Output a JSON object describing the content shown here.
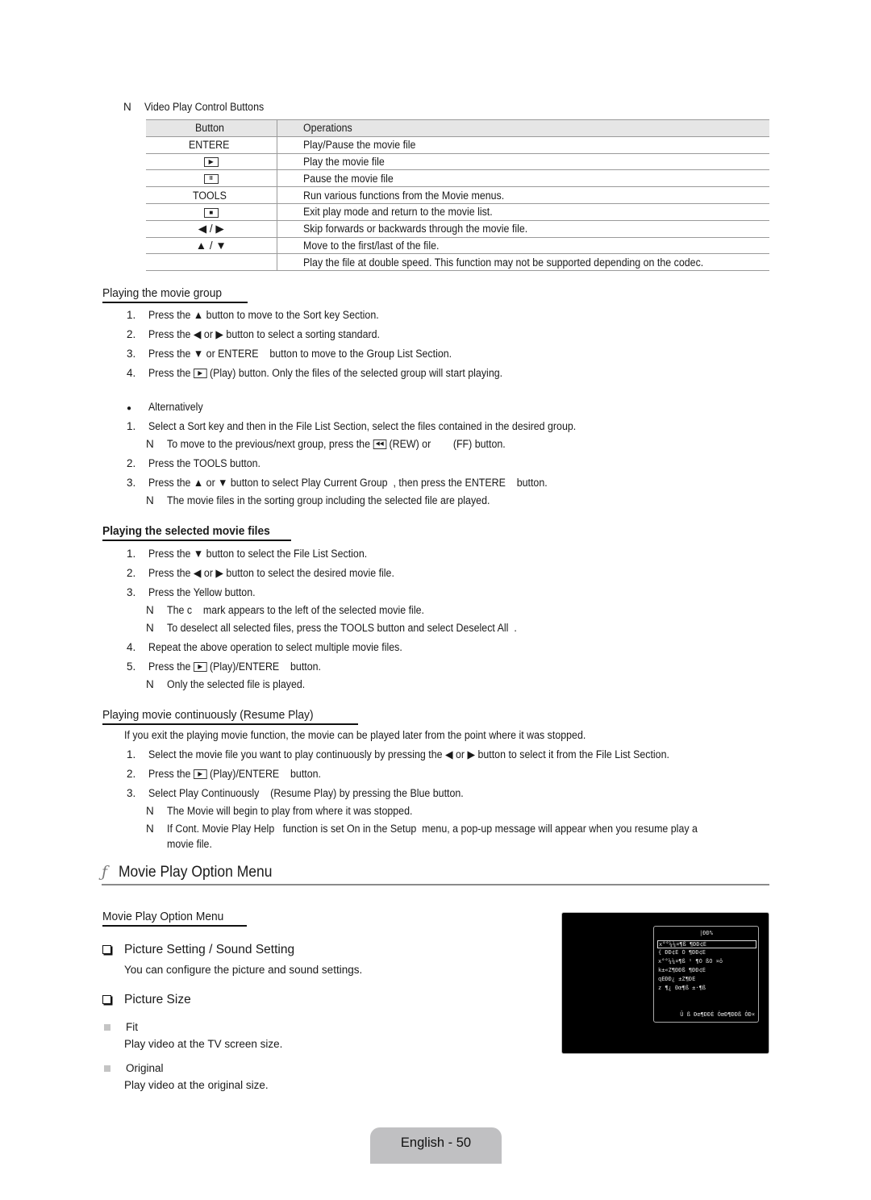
{
  "control_buttons": {
    "note_marker": "N",
    "title": "Video Play Control Buttons",
    "header": {
      "button": "Button",
      "operations": "Operations"
    },
    "rows": [
      {
        "button": "ENTERE",
        "icon": null,
        "operation": "Play/Pause the movie file"
      },
      {
        "button": "",
        "icon": "play-icon",
        "glyph": "▶",
        "operation": "Play the movie file"
      },
      {
        "button": "",
        "icon": "pause-icon",
        "glyph": "II",
        "operation": "Pause the movie file"
      },
      {
        "button": "TOOLS",
        "icon": null,
        "operation": "Run various functions from the Movie menus."
      },
      {
        "button": "",
        "icon": "stop-icon",
        "glyph": "■",
        "operation": "Exit play mode and return to the movie list."
      },
      {
        "button": "◀ / ▶",
        "icon": null,
        "operation": "Skip forwards or backwards through the movie file."
      },
      {
        "button": "▲ / ▼",
        "icon": null,
        "operation": "Move to the first/last of the file."
      },
      {
        "button": "",
        "icon": null,
        "operation": "Play the file at double speed. This function may not be supported depending on the codec."
      }
    ]
  },
  "group_section": {
    "heading": "Playing the movie group",
    "steps": [
      {
        "n": "1.",
        "text": "Press the ▲ button to move to the Sort key Section."
      },
      {
        "n": "2.",
        "text": "Press the ◀ or ▶ button to select a sorting standard."
      },
      {
        "n": "3.",
        "text": "Press the ▼ or ENTERE    button to move to the Group List Section."
      },
      {
        "n": "4.",
        "pre": "Press the",
        "glyph": "▶",
        "post": "(Play) button. Only the files of the selected group will start playing."
      }
    ],
    "alt_bullet": "●",
    "alt_label": "Alternatively",
    "alt_steps": [
      {
        "n": "1.",
        "text": "Select a Sort key and then in the File List Section, select the files contained in the desired group."
      },
      {
        "note": "N",
        "pre": "To move to the previous/next group, press the",
        "glyph": "◀◀",
        "post": "(REW) or        (FF) button."
      },
      {
        "n": "2.",
        "text": "Press the TOOLS button."
      },
      {
        "n": "3.",
        "text": "Press the ▲ or ▼ button to select Play Current Group  , then press the ENTERE    button."
      },
      {
        "note": "N",
        "text": "The movie files in the sorting group including the selected file are played."
      }
    ]
  },
  "selected_section": {
    "heading": "Playing the selected movie files",
    "steps": [
      {
        "n": "1.",
        "text": "Press the ▼ button to select the File List Section."
      },
      {
        "n": "2.",
        "text": "Press the ◀ or ▶ button to select the desired movie file."
      },
      {
        "n": "3.",
        "text": "Press the Yellow button."
      },
      {
        "note": "N",
        "text": "The c    mark appears to the left of the selected movie file."
      },
      {
        "note": "N",
        "text": "To deselect all selected files, press the TOOLS button and select Deselect All  ."
      },
      {
        "n": "4.",
        "text": "Repeat the above operation to select multiple movie files."
      },
      {
        "n": "5.",
        "pre": "Press the",
        "glyph": "▶",
        "post": "(Play)/ENTERE    button."
      },
      {
        "note": "N",
        "text": "Only the selected file is played."
      }
    ]
  },
  "resume_section": {
    "heading": "Playing movie continuously (Resume Play)",
    "intro": "If you exit the playing movie function, the movie can be played later from the point where it was stopped.",
    "steps": [
      {
        "n": "1.",
        "text": "Select the movie file you want to play continuously by pressing the ◀ or ▶ button to select it from the File List Section."
      },
      {
        "n": "2.",
        "pre": "Press the",
        "glyph": "▶",
        "post": "(Play)/ENTERE    button."
      },
      {
        "n": "3.",
        "text": "Select Play Continuously    (Resume Play) by pressing the Blue button."
      },
      {
        "note": "N",
        "text": "The Movie will begin to play from where it was stopped."
      },
      {
        "note": "N",
        "text": "If Cont. Movie Play Help   function is set On in the Setup  menu, a pop-up message will appear when you resume play a",
        "cont": "movie file."
      }
    ]
  },
  "option_menu": {
    "symbol": "ƒ",
    "title": "Movie Play Option Menu",
    "sub_heading": "Movie Play Option Menu",
    "items": [
      {
        "title": "Picture Setting / Sound Setting",
        "desc": "You can configure the picture and sound settings."
      },
      {
        "title": "Picture Size"
      }
    ],
    "sizes": [
      {
        "name": "Fit",
        "desc": "Play video at the TV screen size."
      },
      {
        "name": "Original",
        "desc": "Play video at the original size."
      }
    ]
  },
  "tv_osd": {
    "title": "|ÐÐ%",
    "items": [
      {
        "label": "x°°¼¼¤¶ß ¶ÐÐ¢È",
        "selected": true
      },
      {
        "label": "{ ÐÐ¢È Ó ¶ÐÐ¢È",
        "selected": false
      },
      {
        "label": "x°°¼¼¤¶ß ¹ ¶Ó          ßÓ        ¤ö",
        "selected": false
      },
      {
        "label": "k±«Ž¶ÐÐß ¶ÐÐ¢È",
        "selected": false
      },
      {
        "label": "qÈÐÐ¿ ±Ž¶ÐÈ",
        "selected": false
      },
      {
        "label": "z ¶¿ Ðœ¶ß ±·¶ß",
        "selected": false
      }
    ],
    "footer": "Û ß Ðœ¶ÐÐÈ  ÓœÐ¶ÐÐß  ÓÐ¤"
  },
  "footer": {
    "page_label": "English - 50"
  }
}
